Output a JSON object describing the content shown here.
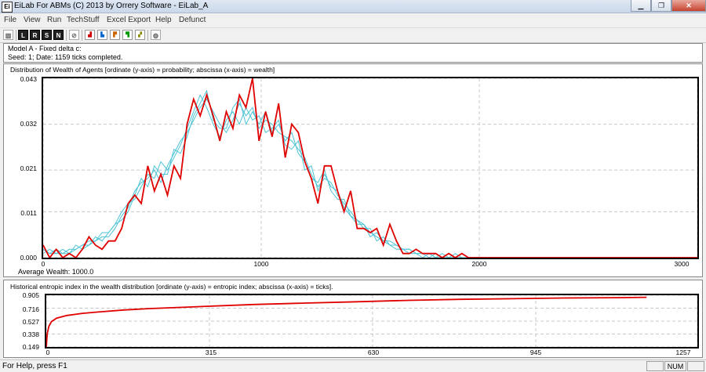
{
  "window": {
    "title": "EiLab For ABMs (C) 2013 by Orrery Software - EiLab_A",
    "icon_label": "Ei",
    "min_glyph": "▁",
    "max_glyph": "❐",
    "close_glyph": "✕"
  },
  "menu": [
    "File",
    "View",
    "Run",
    "TechStuff",
    "Excel Export",
    "Help",
    "Defunct"
  ],
  "toolbar": {
    "buttons": [
      {
        "name": "tool-hatch-icon",
        "glyph": "▨",
        "style": "light"
      },
      {
        "name": "tool-l-icon",
        "glyph": "L",
        "style": "dark"
      },
      {
        "name": "tool-r-icon",
        "glyph": "R",
        "style": "dark"
      },
      {
        "name": "tool-s-icon",
        "glyph": "S",
        "style": "dark"
      },
      {
        "name": "tool-n-icon",
        "glyph": "N",
        "style": "dark"
      },
      {
        "name": "tool-disabled-icon",
        "glyph": "⊘",
        "style": "light"
      },
      {
        "name": "tool-chart1-icon",
        "glyph": "▟",
        "style": "color"
      },
      {
        "name": "tool-chart2-icon",
        "glyph": "▙",
        "style": "color"
      },
      {
        "name": "tool-chart3-icon",
        "glyph": "▛",
        "style": "color"
      },
      {
        "name": "tool-chart4-icon",
        "glyph": "▜",
        "style": "color"
      },
      {
        "name": "tool-chart5-icon",
        "glyph": "▞",
        "style": "color"
      },
      {
        "name": "tool-globe-icon",
        "glyph": "◍",
        "style": "light"
      }
    ]
  },
  "info": {
    "model_line": "Model A - Fixed delta c:",
    "seed_line": "Seed: 1; Date: 1159 ticks completed."
  },
  "colors": {
    "history": "#4ec3d6",
    "current": "#e00000",
    "grid": "#c8c8c8"
  },
  "chart_data": [
    {
      "type": "line",
      "title": "Distribution of Wealth of Agents [ordinate (y-axis) = probability; abscissa (x-axis) = wealth]",
      "ylim": [
        0.0,
        0.043
      ],
      "xlim": [
        0,
        3000
      ],
      "y_tick_labels": [
        "0.043",
        "0.032",
        "0.021",
        "0.011",
        "0.000"
      ],
      "y_tick_values": [
        0.043,
        0.032,
        0.021,
        0.011,
        0.0
      ],
      "x_tick_labels": [
        "0",
        "1000",
        "2000",
        "3000"
      ],
      "x_tick_values": [
        0,
        1000,
        2000,
        3000
      ],
      "footer": "Average Wealth: 1000.0",
      "grid": true,
      "series": [
        {
          "role": "current",
          "x": [
            0,
            30,
            60,
            90,
            120,
            150,
            180,
            210,
            240,
            270,
            300,
            330,
            360,
            390,
            420,
            450,
            480,
            510,
            540,
            570,
            600,
            630,
            660,
            690,
            720,
            750,
            780,
            810,
            840,
            870,
            900,
            930,
            960,
            990,
            1020,
            1050,
            1080,
            1110,
            1140,
            1170,
            1200,
            1230,
            1260,
            1290,
            1320,
            1350,
            1380,
            1410,
            1440,
            1470,
            1500,
            1530,
            1560,
            1590,
            1620,
            1650,
            1680,
            1710,
            1740,
            1770,
            1800,
            1830,
            1860,
            1890,
            1920,
            1950,
            1980,
            2010,
            2040,
            2070,
            2100,
            2200,
            2400,
            2600,
            2800,
            3000
          ],
          "y": [
            0.003,
            0.0,
            0.002,
            0.0,
            0.001,
            0.0,
            0.002,
            0.005,
            0.003,
            0.002,
            0.004,
            0.004,
            0.007,
            0.013,
            0.015,
            0.013,
            0.022,
            0.016,
            0.02,
            0.015,
            0.022,
            0.019,
            0.032,
            0.038,
            0.034,
            0.039,
            0.034,
            0.028,
            0.035,
            0.031,
            0.039,
            0.036,
            0.043,
            0.028,
            0.035,
            0.029,
            0.037,
            0.024,
            0.032,
            0.03,
            0.023,
            0.019,
            0.013,
            0.022,
            0.022,
            0.016,
            0.011,
            0.016,
            0.007,
            0.007,
            0.006,
            0.007,
            0.003,
            0.008,
            0.004,
            0.001,
            0.001,
            0.002,
            0.001,
            0.001,
            0.001,
            0.0,
            0.001,
            0.0,
            0.001,
            0.0,
            0.0,
            0.0,
            0.0,
            0.0,
            0.0,
            0.0,
            0.0,
            0.0,
            0.0,
            0.0
          ]
        },
        {
          "role": "history",
          "x": [
            0,
            30,
            60,
            90,
            120,
            150,
            180,
            210,
            240,
            270,
            300,
            330,
            360,
            390,
            420,
            450,
            480,
            510,
            540,
            570,
            600,
            630,
            660,
            690,
            720,
            750,
            780,
            810,
            840,
            870,
            900,
            930,
            960,
            990,
            1020,
            1050,
            1080,
            1110,
            1140,
            1170,
            1200,
            1230,
            1260,
            1290,
            1320,
            1350,
            1380,
            1410,
            1440,
            1470,
            1500,
            1530,
            1560,
            1590,
            1620,
            1650,
            1680,
            1710,
            1740,
            1770,
            1800,
            1830,
            1860,
            1890,
            1920,
            1950,
            1980,
            2010,
            2040,
            2070,
            2100
          ],
          "y": [
            0.002,
            0.001,
            0.001,
            0.002,
            0.001,
            0.002,
            0.003,
            0.003,
            0.004,
            0.005,
            0.005,
            0.007,
            0.01,
            0.012,
            0.016,
            0.018,
            0.019,
            0.021,
            0.018,
            0.022,
            0.025,
            0.028,
            0.03,
            0.033,
            0.036,
            0.038,
            0.035,
            0.032,
            0.03,
            0.033,
            0.037,
            0.034,
            0.036,
            0.031,
            0.033,
            0.032,
            0.03,
            0.029,
            0.028,
            0.026,
            0.024,
            0.02,
            0.017,
            0.019,
            0.018,
            0.015,
            0.013,
            0.011,
            0.009,
            0.008,
            0.006,
            0.005,
            0.004,
            0.004,
            0.003,
            0.002,
            0.002,
            0.001,
            0.001,
            0.001,
            0.0,
            0.001,
            0.0,
            0.0,
            0.0,
            0.0,
            0.0,
            0.0,
            0.0,
            0.0,
            0.0
          ]
        },
        {
          "role": "history",
          "x": [
            0,
            30,
            60,
            90,
            120,
            150,
            180,
            210,
            240,
            270,
            300,
            330,
            360,
            390,
            420,
            450,
            480,
            510,
            540,
            570,
            600,
            630,
            660,
            690,
            720,
            750,
            780,
            810,
            840,
            870,
            900,
            930,
            960,
            990,
            1020,
            1050,
            1080,
            1110,
            1140,
            1170,
            1200,
            1230,
            1260,
            1290,
            1320,
            1350,
            1380,
            1410,
            1440,
            1470,
            1500,
            1530,
            1560,
            1590,
            1620,
            1650,
            1680,
            1710,
            1740,
            1770,
            1800,
            1830,
            1860,
            1890,
            1920,
            1950,
            1980,
            2010,
            2040,
            2070,
            2100
          ],
          "y": [
            0.001,
            0.002,
            0.001,
            0.001,
            0.002,
            0.002,
            0.003,
            0.004,
            0.004,
            0.006,
            0.006,
            0.008,
            0.011,
            0.013,
            0.014,
            0.017,
            0.02,
            0.019,
            0.023,
            0.021,
            0.024,
            0.027,
            0.031,
            0.035,
            0.039,
            0.036,
            0.032,
            0.029,
            0.033,
            0.035,
            0.032,
            0.036,
            0.033,
            0.034,
            0.03,
            0.031,
            0.033,
            0.027,
            0.026,
            0.028,
            0.021,
            0.022,
            0.016,
            0.02,
            0.017,
            0.016,
            0.012,
            0.01,
            0.009,
            0.007,
            0.007,
            0.004,
            0.005,
            0.003,
            0.003,
            0.002,
            0.001,
            0.001,
            0.001,
            0.0,
            0.001,
            0.0,
            0.0,
            0.001,
            0.0,
            0.0,
            0.0,
            0.0,
            0.0,
            0.0,
            0.0
          ]
        },
        {
          "role": "history",
          "x": [
            0,
            30,
            60,
            90,
            120,
            150,
            180,
            210,
            240,
            270,
            300,
            330,
            360,
            390,
            420,
            450,
            480,
            510,
            540,
            570,
            600,
            630,
            660,
            690,
            720,
            750,
            780,
            810,
            840,
            870,
            900,
            930,
            960,
            990,
            1020,
            1050,
            1080,
            1110,
            1140,
            1170,
            1200,
            1230,
            1260,
            1290,
            1320,
            1350,
            1380,
            1410,
            1440,
            1470,
            1500,
            1530,
            1560,
            1590,
            1620,
            1650,
            1680,
            1710,
            1740,
            1770,
            1800,
            1830,
            1860,
            1890,
            1920,
            1950,
            1980,
            2010,
            2040,
            2070,
            2100
          ],
          "y": [
            0.002,
            0.001,
            0.002,
            0.001,
            0.001,
            0.003,
            0.002,
            0.003,
            0.005,
            0.004,
            0.006,
            0.008,
            0.009,
            0.011,
            0.015,
            0.019,
            0.017,
            0.022,
            0.02,
            0.02,
            0.026,
            0.025,
            0.029,
            0.034,
            0.037,
            0.04,
            0.033,
            0.031,
            0.031,
            0.036,
            0.038,
            0.032,
            0.035,
            0.032,
            0.035,
            0.03,
            0.032,
            0.028,
            0.03,
            0.025,
            0.023,
            0.019,
            0.018,
            0.021,
            0.016,
            0.014,
            0.014,
            0.01,
            0.008,
            0.008,
            0.005,
            0.006,
            0.004,
            0.003,
            0.002,
            0.002,
            0.002,
            0.001,
            0.0,
            0.001,
            0.0,
            0.0,
            0.001,
            0.0,
            0.0,
            0.0,
            0.0,
            0.0,
            0.0,
            0.0,
            0.0
          ]
        }
      ]
    },
    {
      "type": "line",
      "title": "Historical entropic index in the wealth distribution [ordinate (y-axis) = entropic index; abscissa (x-axis) = ticks].",
      "ylim": [
        0.149,
        0.905
      ],
      "xlim": [
        0,
        1257
      ],
      "y_tick_labels": [
        "0.905",
        "0.716",
        "0.527",
        "0.338",
        "0.149"
      ],
      "y_tick_values": [
        0.905,
        0.716,
        0.527,
        0.338,
        0.149
      ],
      "x_tick_labels": [
        "0",
        "315",
        "630",
        "945",
        "1257"
      ],
      "x_tick_values": [
        0,
        315,
        630,
        945,
        1257
      ],
      "grid": true,
      "series": [
        {
          "role": "current",
          "x": [
            0,
            2,
            5,
            10,
            20,
            40,
            70,
            100,
            150,
            200,
            300,
            400,
            500,
            600,
            700,
            800,
            900,
            1000,
            1100,
            1159
          ],
          "y": [
            0.15,
            0.35,
            0.45,
            0.52,
            0.57,
            0.61,
            0.64,
            0.66,
            0.69,
            0.71,
            0.74,
            0.77,
            0.79,
            0.81,
            0.83,
            0.845,
            0.855,
            0.865,
            0.87,
            0.875
          ]
        }
      ]
    }
  ],
  "status": {
    "help_text": "For Help, press F1",
    "num": "NUM"
  }
}
